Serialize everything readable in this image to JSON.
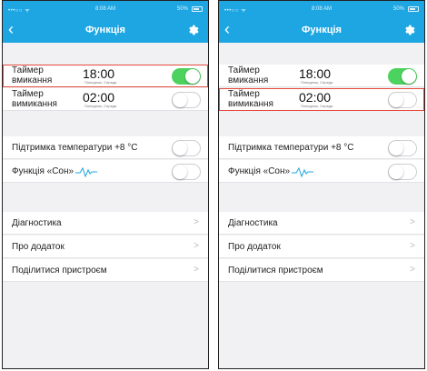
{
  "status": {
    "carrier": "•••○○ ᯤ",
    "time": "8:08 AM",
    "battery": "50%"
  },
  "nav": {
    "title": "Функція"
  },
  "timers": {
    "on": {
      "label": "Таймер вмикання",
      "time": "18:00",
      "days": "Понеділок, Середа"
    },
    "off": {
      "label": "Таймер вимикання",
      "time": "02:00",
      "days": "Понеділок, Середа"
    }
  },
  "features": {
    "temp_support": "Підтримка температури +8 °C",
    "sleep": "Функція «Сон»"
  },
  "menu": {
    "diagnostics": "Діагностика",
    "about": "Про додаток",
    "share": "Поділитися пристроєм",
    "chevron": ">"
  },
  "screens": [
    {
      "highlight": "timer-on",
      "timer_on": true,
      "timer_off": false,
      "temp": false,
      "sleep": false
    },
    {
      "highlight": "timer-off",
      "timer_on": true,
      "timer_off": false,
      "temp": false,
      "sleep": false
    }
  ],
  "colors": {
    "accent": "#1ea6e3",
    "toggle_on": "#4cd25e",
    "highlight": "#e34b3c"
  }
}
